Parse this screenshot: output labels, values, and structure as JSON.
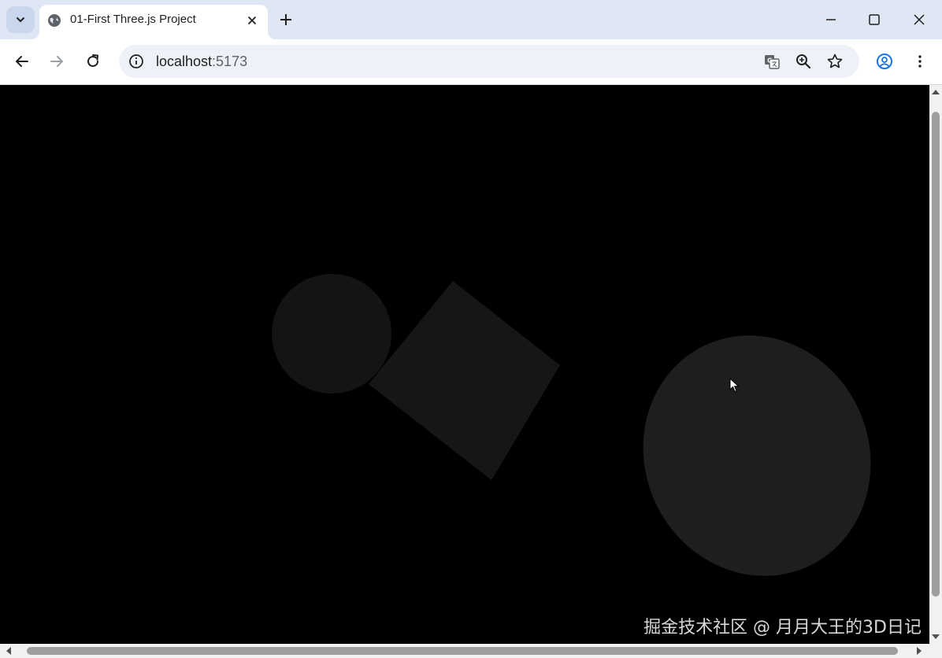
{
  "tab": {
    "title": "01-First Three.js Project"
  },
  "address": {
    "host": "localhost",
    "port": ":5173"
  },
  "watermark": "掘金技术社区 @ 月月大王的3D日记",
  "icons": {
    "tab_search": "chevron-down-icon",
    "favicon": "globe-icon",
    "tab_close": "close-icon",
    "new_tab": "plus-icon",
    "back": "arrow-left-icon",
    "forward": "arrow-right-icon",
    "reload": "reload-icon",
    "site_info": "info-icon",
    "translate": "translate-icon",
    "zoom": "zoom-icon",
    "bookmark": "star-icon",
    "profile": "profile-icon",
    "menu": "kebab-menu-icon"
  },
  "colors": {
    "tabstrip": "#dfe7f5",
    "page_background": "#000000",
    "mesh": "#1a1a1a"
  }
}
